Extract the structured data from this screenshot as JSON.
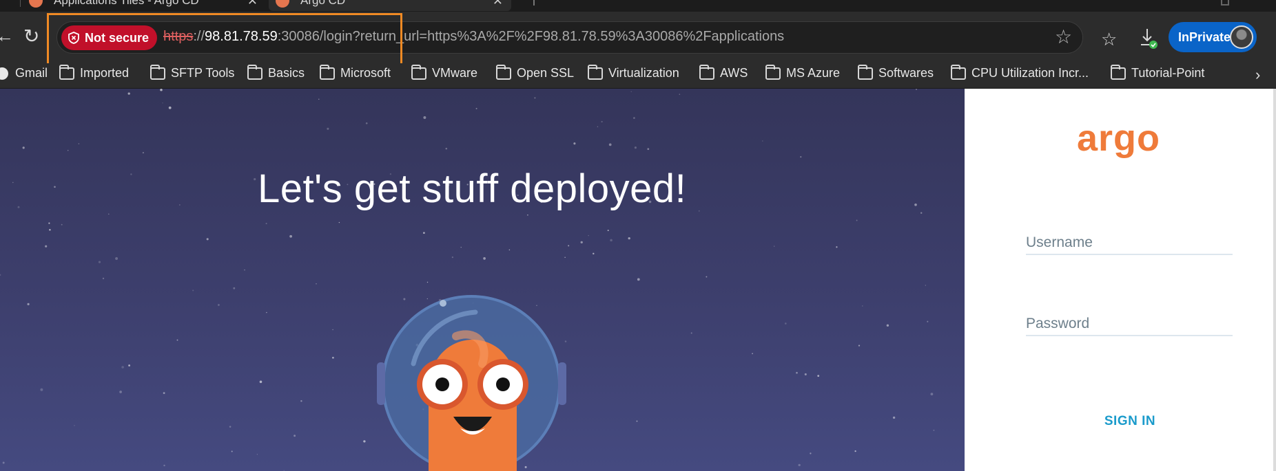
{
  "browser": {
    "tabs": [
      {
        "title": "Applications Tiles - Argo CD",
        "active": false
      },
      {
        "title": "Argo CD",
        "active": true
      }
    ],
    "address": {
      "security_label": "Not secure",
      "url_protocol": "https",
      "url_sep": "://",
      "url_host": "98.81.78.59",
      "url_rest": ":30086/login?return_url=https%3A%2F%2F98.81.78.59%3A30086%2Fapplications"
    },
    "profile_label": "InPrivate",
    "bookmarks": [
      {
        "label": "Gmail",
        "icon": "gmail-icon"
      },
      {
        "label": "Imported",
        "icon": "folder-icon"
      },
      {
        "label": "SFTP Tools",
        "icon": "folder-icon"
      },
      {
        "label": "Basics",
        "icon": "folder-icon"
      },
      {
        "label": "Microsoft",
        "icon": "folder-icon"
      },
      {
        "label": "VMware",
        "icon": "folder-icon"
      },
      {
        "label": "Open SSL",
        "icon": "folder-icon"
      },
      {
        "label": "Virtualization",
        "icon": "folder-icon"
      },
      {
        "label": "AWS",
        "icon": "folder-icon"
      },
      {
        "label": "MS Azure",
        "icon": "folder-icon"
      },
      {
        "label": "Softwares",
        "icon": "folder-icon"
      },
      {
        "label": "CPU Utilization Incr...",
        "icon": "folder-icon"
      },
      {
        "label": "Tutorial-Point",
        "icon": "folder-icon"
      }
    ],
    "highlight_color": "#f08a24"
  },
  "page": {
    "hero_title": "Let's get stuff deployed!",
    "logo_text": "argo",
    "username_placeholder": "Username",
    "password_placeholder": "Password",
    "signin_label": "SIGN IN",
    "colors": {
      "brand_orange": "#ef7b3a",
      "signin_blue": "#1b9bcb",
      "not_secure_red": "#c1102a",
      "inprivate_blue": "#0a64c8"
    }
  }
}
